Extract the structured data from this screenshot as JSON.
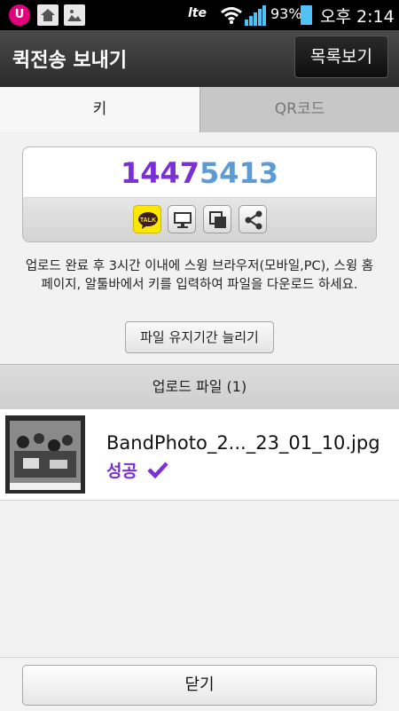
{
  "status_bar": {
    "carrier_icon": "lg-uplus-icon",
    "network": "lte",
    "battery": "93%",
    "time": "오후 2:14"
  },
  "header": {
    "title": "퀵전송 보내기",
    "list_button": "목록보기"
  },
  "tabs": [
    {
      "label": "키",
      "selected": true
    },
    {
      "label": "QR코드",
      "selected": false
    }
  ],
  "key": {
    "part1": "1447",
    "part2": "5413",
    "colors": {
      "part1": "#7b2fd6",
      "part2": "#5b9bd6"
    },
    "share_buttons": [
      "kakaotalk-icon",
      "pc-monitor-icon",
      "copy-icon",
      "share-icon"
    ],
    "talk_label": "TALK"
  },
  "info_text": "업로드 완료 후 3시간 이내에 스윙 브라우저(모바일,PC), 스윙 홈페이지, 알툴바에서 키를 입력하여 파일을 다운로드 하세요.",
  "extend_button": "파일 유지기간 늘리기",
  "upload_section": {
    "title": "업로드 파일 (1)"
  },
  "files": [
    {
      "name": "BandPhoto_2..._23_01_10.jpg",
      "status": "성공"
    }
  ],
  "close_button": "닫기"
}
